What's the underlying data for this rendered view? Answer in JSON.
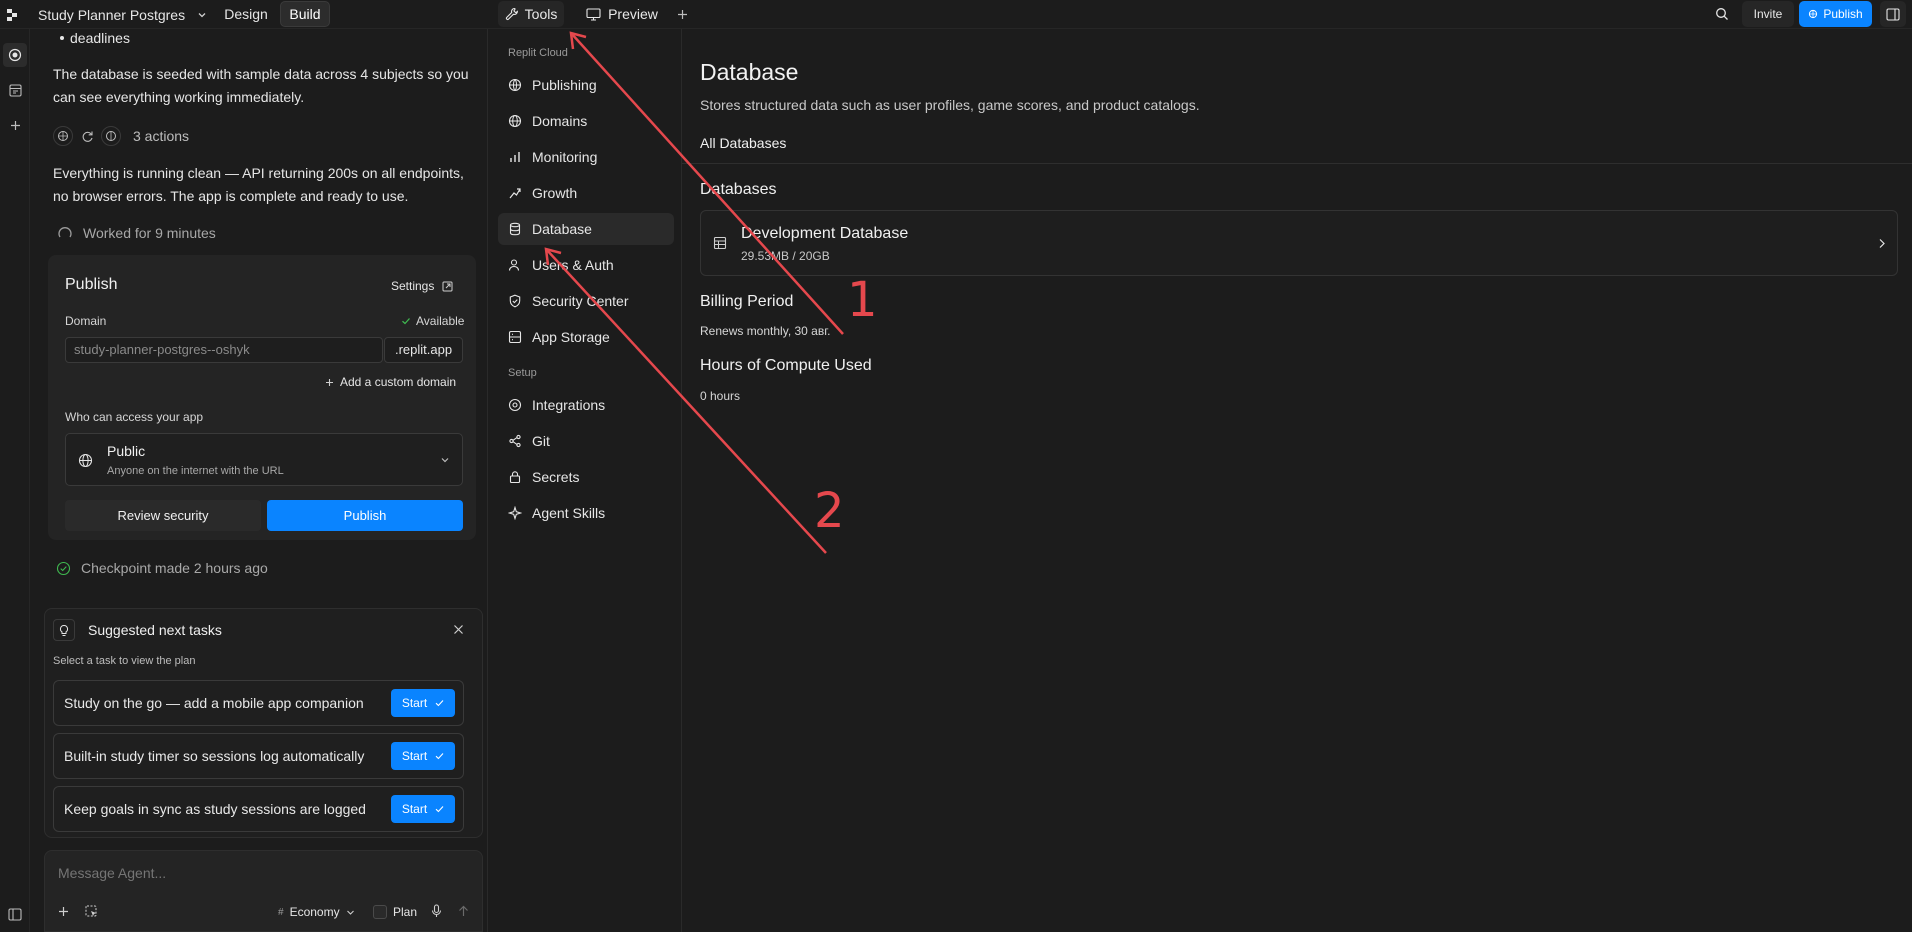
{
  "topbar": {
    "project_name": "Study Planner Postgres",
    "mode_tabs": [
      "Design",
      "Build"
    ],
    "tools_tab": "Tools",
    "preview_tab": "Preview",
    "invite_label": "Invite",
    "publish_label": "Publish"
  },
  "chat": {
    "trailing_bullet": "deadlines",
    "para1_line1": "The database is seeded with sample data across 4 subjects so you",
    "para1_line2": "can see everything working immediately.",
    "actions_label": "3 actions",
    "para2_line1": "Everything is running clean — API returning 200s on all endpoints,",
    "para2_line2": "no browser errors. The app is complete and ready to use.",
    "worked_label": "Worked for 9 minutes",
    "publish_card": {
      "title": "Publish",
      "settings_label": "Settings",
      "domain_label": "Domain",
      "available_label": "Available",
      "domain_value": "study-planner-postgres--oshyk",
      "domain_suffix": ".replit.app",
      "custom_domain": "Add a custom domain",
      "access_label": "Who can access your app",
      "access_value": "Public",
      "access_desc": "Anyone on the internet with the URL",
      "review_button": "Review security",
      "publish_button": "Publish"
    },
    "checkpoint_label": "Checkpoint made 2 hours ago",
    "suggested": {
      "title": "Suggested next tasks",
      "subtitle": "Select a task to view the plan",
      "tasks": [
        {
          "label": "Study on the go — add a mobile app companion",
          "button": "Start"
        },
        {
          "label": "Built-in study timer so sessions log automatically",
          "button": "Start"
        },
        {
          "label": "Keep goals in sync as study sessions are logged",
          "button": "Start"
        }
      ]
    },
    "composer": {
      "placeholder": "Message Agent...",
      "model_label": "Economy",
      "plan_label": "Plan"
    }
  },
  "nav": {
    "section_cloud": "Replit Cloud",
    "cloud_items": [
      "Publishing",
      "Domains",
      "Monitoring",
      "Growth",
      "Database",
      "Users & Auth",
      "Security Center",
      "App Storage"
    ],
    "section_setup": "Setup",
    "setup_items": [
      "Integrations",
      "Git",
      "Secrets",
      "Agent Skills"
    ],
    "active_item": "Database"
  },
  "main": {
    "title": "Database",
    "description": "Stores structured data such as user profiles, game scores, and product catalogs.",
    "tab": "All Databases",
    "databases_heading": "Databases",
    "db_card": {
      "name": "Development Database",
      "usage": "29.53MB / 20GB"
    },
    "billing_heading": "Billing Period",
    "billing_value": "Renews monthly, 30 авг.",
    "compute_heading": "Hours of Compute Used",
    "compute_value": "0 hours"
  },
  "annotations": {
    "label_1": "1",
    "label_2": "2",
    "color": "#e5484d"
  },
  "colors": {
    "accent": "#0a84ff",
    "background": "#1c1c1c",
    "card": "#242424",
    "available": "#3fb950"
  }
}
